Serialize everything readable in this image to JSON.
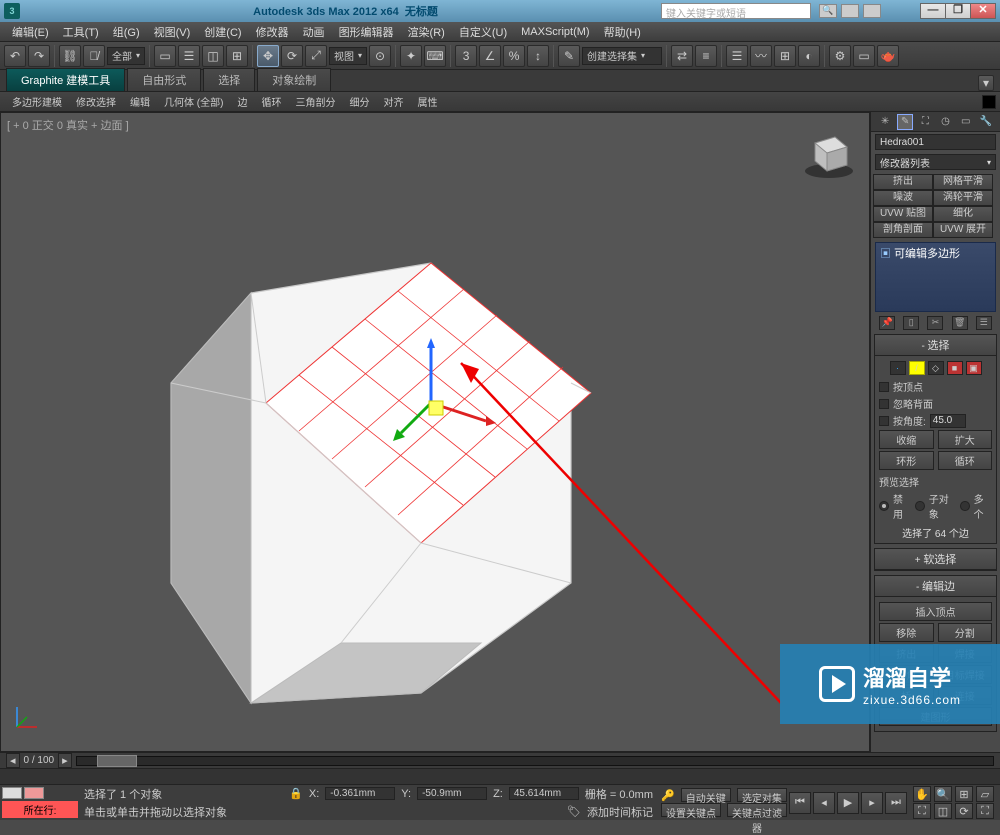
{
  "title": {
    "app": "Autodesk 3ds Max  2012 x64",
    "doc": "无标题",
    "search_placeholder": "键入关键字或短语"
  },
  "menu": [
    "编辑(E)",
    "工具(T)",
    "组(G)",
    "视图(V)",
    "创建(C)",
    "修改器",
    "动画",
    "图形编辑器",
    "渲染(R)",
    "自定义(U)",
    "MAXScript(M)",
    "帮助(H)"
  ],
  "toolbar": {
    "combo_all": "全部",
    "combo_view": "视图",
    "combo_selset": "创建选择集"
  },
  "ribbon": {
    "tabs": [
      "Graphite 建模工具",
      "自由形式",
      "选择",
      "对象绘制"
    ],
    "sub": [
      "多边形建模",
      "修改选择",
      "编辑",
      "几何体 (全部)",
      "边",
      "循环",
      "三角剖分",
      "细分",
      "对齐",
      "属性"
    ]
  },
  "viewport": {
    "label": "[ + 0 正交 0 真实 + 边面 ]"
  },
  "panel": {
    "object_name": "Hedra001",
    "mod_list_label": "修改器列表",
    "mod_buttons": [
      "挤出",
      "网格平滑",
      "噪波",
      "涡轮平滑",
      "UVW 贴图",
      "细化",
      "剖角剖面",
      "UVW 展开"
    ],
    "stack_item": "可编辑多边形",
    "rollouts": {
      "selection": {
        "title": "选择",
        "by_vertex": "按顶点",
        "ignore_backface": "忽略背面",
        "by_angle": "按角度:",
        "angle_value": "45.0",
        "shrink": "收缩",
        "grow": "扩大",
        "ring": "环形",
        "loop": "循环",
        "preview_label": "预览选择",
        "disable": "禁用",
        "subobj": "子对象",
        "multi": "多个",
        "sel_count": "选择了 64 个边"
      },
      "soft_sel": "软选择",
      "edit_edges": {
        "title": "编辑边",
        "insert_vertex": "插入顶点",
        "remove": "移除",
        "split": "分割",
        "extrude": "挤出",
        "weld": "焊接",
        "chamfer": "切角",
        "target_weld": "目标焊接",
        "bridge": "桥",
        "connect": "连接",
        "create_shape": "建图形"
      }
    }
  },
  "status": {
    "frame_display": "0 / 100",
    "current_row": "所在行:",
    "sel_msg": "选择了 1 个对象",
    "hint": "单击或单击并拖动以选择对象",
    "add_time_tag": "添加时间标记",
    "coords": {
      "x": "-0.361mm",
      "y": "-50.9mm",
      "z": "45.614mm"
    },
    "grid": "栅格 = 0.0mm",
    "auto_key": "自动关键点",
    "sel_set": "选定对集",
    "set_key": "设置关键点",
    "key_filters": "关键点过滤器"
  },
  "watermark": {
    "brand": "溜溜自学",
    "url": "zixue.3d66.com"
  }
}
